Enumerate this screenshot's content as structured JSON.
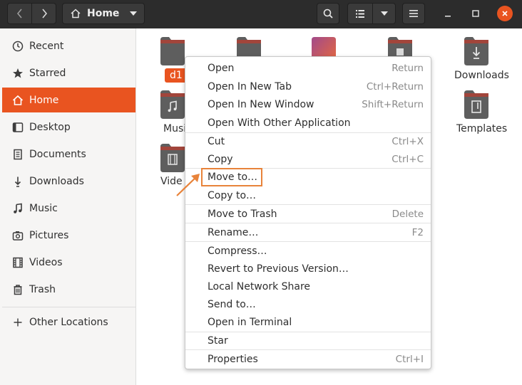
{
  "header": {
    "path_label": "Home",
    "icons": {
      "back": "chevron-left-icon",
      "forward": "chevron-right-icon",
      "home": "home-icon",
      "path_menu": "chevron-down-icon",
      "search": "search-icon",
      "view_list": "list-view-icon",
      "view_options": "chevron-down-icon",
      "menu": "hamburger-icon",
      "minimize": "minimize-icon",
      "maximize": "maximize-icon",
      "close": "close-icon"
    },
    "colors": {
      "bar": "#2c2c2c",
      "close": "#e95420"
    }
  },
  "sidebar": {
    "items": [
      {
        "label": "Recent",
        "icon": "clock-icon"
      },
      {
        "label": "Starred",
        "icon": "star-icon"
      },
      {
        "label": "Home",
        "icon": "home-icon",
        "active": true
      },
      {
        "label": "Desktop",
        "icon": "desktop-icon"
      },
      {
        "label": "Documents",
        "icon": "document-icon"
      },
      {
        "label": "Downloads",
        "icon": "download-icon"
      },
      {
        "label": "Music",
        "icon": "music-icon"
      },
      {
        "label": "Pictures",
        "icon": "camera-icon"
      },
      {
        "label": "Videos",
        "icon": "film-icon"
      },
      {
        "label": "Trash",
        "icon": "trash-icon"
      }
    ],
    "other_locations": {
      "label": "Other Locations",
      "icon": "plus-icon"
    },
    "accent": "#e95420"
  },
  "files": {
    "d1": "d1",
    "music": "Musi",
    "videos": "Vide",
    "downloads": "Downloads",
    "templates": "Templates"
  },
  "context_menu": {
    "groups": [
      [
        {
          "label": "Open",
          "accel": "Return"
        },
        {
          "label": "Open In New Tab",
          "accel": "Ctrl+Return"
        },
        {
          "label": "Open In New Window",
          "accel": "Shift+Return"
        },
        {
          "label": "Open With Other Application",
          "accel": ""
        }
      ],
      [
        {
          "label": "Cut",
          "accel": "Ctrl+X"
        },
        {
          "label": "Copy",
          "accel": "Ctrl+C"
        }
      ],
      [
        {
          "label": "Move to…",
          "accel": ""
        },
        {
          "label": "Copy to…",
          "accel": ""
        }
      ],
      [
        {
          "label": "Move to Trash",
          "accel": "Delete"
        }
      ],
      [
        {
          "label": "Rename…",
          "accel": "F2"
        }
      ],
      [
        {
          "label": "Compress…",
          "accel": ""
        },
        {
          "label": "Revert to Previous Version…",
          "accel": ""
        },
        {
          "label": "Local Network Share",
          "accel": ""
        },
        {
          "label": "Send to…",
          "accel": ""
        },
        {
          "label": "Open in Terminal",
          "accel": ""
        }
      ],
      [
        {
          "label": "Star",
          "accel": ""
        }
      ],
      [
        {
          "label": "Properties",
          "accel": "Ctrl+I"
        }
      ]
    ],
    "highlight_color": "#e8833a"
  }
}
